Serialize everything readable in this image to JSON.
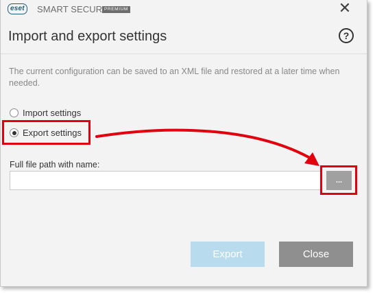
{
  "titlebar": {
    "logo_text": "eset",
    "product_name": "SMART SECURITY",
    "edition_badge": "PREMIUM",
    "close_icon": "close-icon"
  },
  "header": {
    "title": "Import and export settings",
    "help_icon": "?"
  },
  "description": "The current configuration can be saved to an XML file and restored at a later time when needed.",
  "options": [
    {
      "label": "Import settings",
      "selected": false
    },
    {
      "label": "Export settings",
      "selected": true
    }
  ],
  "file_path": {
    "label": "Full file path with name:",
    "value": "",
    "browse_label": "..."
  },
  "buttons": {
    "export_label": "Export",
    "close_label": "Close"
  },
  "colors": {
    "annotation_red": "#e2000f",
    "export_button_disabled": "#b8dced",
    "close_button": "#8f8f8f",
    "browse_button": "#a0a0a0"
  }
}
